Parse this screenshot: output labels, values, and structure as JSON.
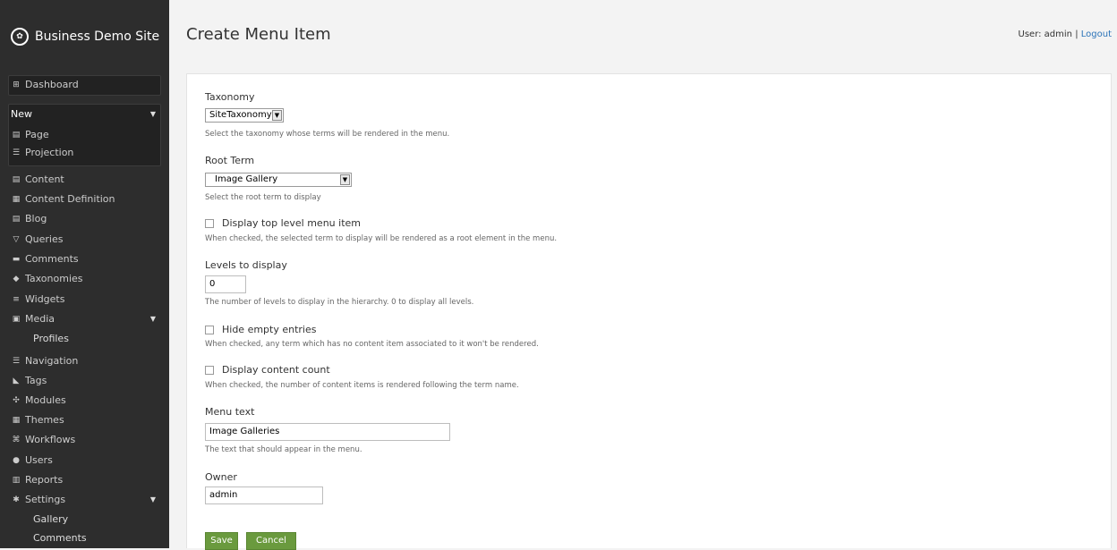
{
  "sidebar": {
    "site_title": "Business Demo Site",
    "dashboard": "Dashboard",
    "new_header": "New",
    "new_items": [
      "Page",
      "Projection"
    ],
    "items": [
      "Content",
      "Content Definition",
      "Blog",
      "Queries",
      "Comments",
      "Taxonomies",
      "Widgets",
      "Media",
      "Profiles",
      "Navigation",
      "Tags",
      "Modules",
      "Themes",
      "Workflows",
      "Users",
      "Reports",
      "Settings",
      "Gallery",
      "Comments"
    ]
  },
  "header": {
    "title": "Create Menu Item",
    "user_prefix": "User: admin | ",
    "logout": "Logout"
  },
  "form": {
    "taxonomy_label": "Taxonomy",
    "taxonomy_value": "SiteTaxonomy",
    "taxonomy_hint": "Select the taxonomy whose terms will be rendered in the menu.",
    "root_term_label": "Root Term",
    "root_term_value": "Image Gallery",
    "root_term_hint": "Select the root term to display",
    "display_top_label": "Display top level menu item",
    "display_top_hint": "When checked, the selected term to display will be rendered as a root element in the menu.",
    "levels_label": "Levels to display",
    "levels_value": "0",
    "levels_hint": "The number of levels to display in the hierarchy. 0 to display all levels.",
    "hide_empty_label": "Hide empty entries",
    "hide_empty_hint": "When checked, any term which has no content item associated to it won't be rendered.",
    "content_count_label": "Display content count",
    "content_count_hint": "When checked, the number of content items is rendered following the term name.",
    "menu_text_label": "Menu text",
    "menu_text_value": "Image Galleries",
    "menu_text_hint": "The text that should appear in the menu.",
    "owner_label": "Owner",
    "owner_value": "admin",
    "save": "Save",
    "cancel": "Cancel"
  },
  "colors": {
    "sidebar_bg": "#2d2d2d",
    "button_green": "#6a9a3e",
    "link_blue": "#2b73b8"
  }
}
